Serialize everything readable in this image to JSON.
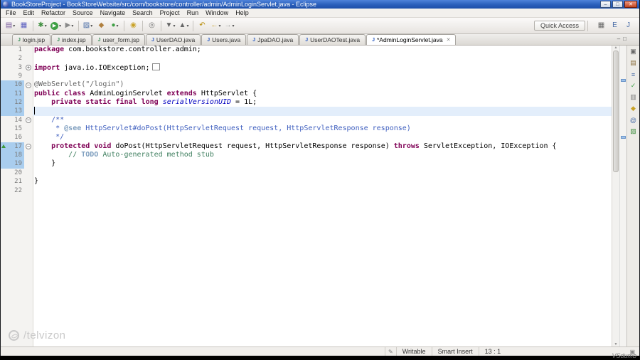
{
  "window": {
    "title": "BookStoreProject - BookStoreWebsite/src/com/bookstore/controller/admin/AdminLoginServlet.java - Eclipse",
    "controls": [
      {
        "name": "minimize-button",
        "glyph": "–"
      },
      {
        "name": "maximize-button",
        "glyph": "□"
      },
      {
        "name": "close-button",
        "glyph": "✕"
      }
    ]
  },
  "menu": {
    "items": [
      "File",
      "Edit",
      "Refactor",
      "Source",
      "Navigate",
      "Search",
      "Project",
      "Run",
      "Window",
      "Help"
    ]
  },
  "toolbar": {
    "quick_access": "Quick Access",
    "groups": [
      {
        "icons": [
          {
            "name": "new-wizard-icon",
            "glyph": "▤",
            "color": "#7a5c9e",
            "dd": true
          },
          {
            "name": "save-icon",
            "glyph": "▦",
            "color": "#5b5fc0"
          }
        ]
      },
      {
        "icons": [
          {
            "name": "debug-icon",
            "glyph": "✱",
            "color": "#3f8f3f",
            "dd": true
          },
          {
            "name": "run-icon",
            "glyph": "▶",
            "color": "#ffffff",
            "bg": "#3fa045",
            "dd": true
          },
          {
            "name": "external-tools-icon",
            "glyph": "▶",
            "color": "#8a8a8a",
            "dd": true
          }
        ]
      },
      {
        "icons": [
          {
            "name": "new-java-project-icon",
            "glyph": "▨",
            "color": "#4a6da7",
            "dd": true
          },
          {
            "name": "new-package-icon",
            "glyph": "◆",
            "color": "#b08040"
          },
          {
            "name": "new-class-icon",
            "glyph": "●",
            "color": "#3fa045",
            "dd": true
          }
        ]
      },
      {
        "icons": [
          {
            "name": "search-icon",
            "glyph": "◉",
            "color": "#c9a227"
          }
        ]
      },
      {
        "icons": [
          {
            "name": "mark-occurrences-icon",
            "glyph": "◎",
            "color": "#777777"
          }
        ]
      },
      {
        "icons": [
          {
            "name": "next-annotation-icon",
            "glyph": "▼",
            "color": "#666666",
            "dd": true
          },
          {
            "name": "previous-annotation-icon",
            "glyph": "▲",
            "color": "#666666",
            "dd": true
          }
        ]
      },
      {
        "icons": [
          {
            "name": "last-edit-location-icon",
            "glyph": "↶",
            "color": "#b58900"
          },
          {
            "name": "back-icon",
            "glyph": "←",
            "color": "#c9a227",
            "dd": true
          },
          {
            "name": "forward-icon",
            "glyph": "→",
            "color": "#9a9a9a",
            "dd": true
          }
        ]
      }
    ],
    "perspectives": [
      {
        "name": "open-perspective-icon",
        "glyph": "▦",
        "color": "#666666"
      },
      {
        "name": "java-ee-perspective-icon",
        "glyph": "E",
        "color": "#4a6da7"
      },
      {
        "name": "java-perspective-icon",
        "glyph": "J",
        "color": "#4a6da7"
      }
    ]
  },
  "view_buttons": [
    {
      "name": "minimize-view-icon",
      "glyph": "–"
    },
    {
      "name": "maximize-view-icon",
      "glyph": "□"
    }
  ],
  "tabs": [
    {
      "label": "login.jsp",
      "type": "jsp",
      "active": false
    },
    {
      "label": "index.jsp",
      "type": "jsp",
      "active": false
    },
    {
      "label": "user_form.jsp",
      "type": "jsp",
      "active": false
    },
    {
      "label": "UserDAO.java",
      "type": "java",
      "active": false
    },
    {
      "label": "Users.java",
      "type": "java",
      "active": false
    },
    {
      "label": "JpaDAO.java",
      "type": "java",
      "active": false
    },
    {
      "label": "UserDAOTest.java",
      "type": "java",
      "active": false
    },
    {
      "label": "*AdminLoginServlet.java",
      "type": "java",
      "active": true
    }
  ],
  "ui": {
    "close_glyph": "✕",
    "dropdown_glyph": "▾",
    "scroll_up_glyph": "▲",
    "scroll_down_glyph": "▼",
    "jsp_icon_letter": "J",
    "java_icon_letter": "J"
  },
  "editor": {
    "lines": [
      {
        "n": "1",
        "segs": [
          [
            "kw",
            "package"
          ],
          [
            "pl",
            " com.bookstore.controller.admin;"
          ]
        ]
      },
      {
        "n": "2",
        "segs": []
      },
      {
        "n": "3",
        "fold": "plus",
        "segs": [
          [
            "kw",
            "import"
          ],
          [
            "pl",
            " java.io.IOException;"
          ],
          [
            "box",
            ""
          ]
        ]
      },
      {
        "n": "9",
        "segs": []
      },
      {
        "n": "10",
        "fold": "minus",
        "diff": true,
        "segs": [
          [
            "ann",
            "@WebServlet(\"/login\")"
          ]
        ]
      },
      {
        "n": "11",
        "diff": true,
        "segs": [
          [
            "kw",
            "public"
          ],
          [
            "pl",
            " "
          ],
          [
            "kw",
            "class"
          ],
          [
            "pl",
            " AdminLoginServlet "
          ],
          [
            "kw",
            "extends"
          ],
          [
            "pl",
            " HttpServlet {"
          ]
        ]
      },
      {
        "n": "12",
        "diff": true,
        "segs": [
          [
            "pl",
            "    "
          ],
          [
            "kw",
            "private"
          ],
          [
            "pl",
            " "
          ],
          [
            "kw",
            "static"
          ],
          [
            "pl",
            " "
          ],
          [
            "kw",
            "final"
          ],
          [
            "pl",
            " "
          ],
          [
            "kw",
            "long"
          ],
          [
            "pl",
            " "
          ],
          [
            "fld",
            "serialVersionUID"
          ],
          [
            "pl",
            " = 1L;"
          ]
        ]
      },
      {
        "n": "13",
        "diff": true,
        "current": true,
        "caret": true,
        "segs": []
      },
      {
        "n": "14",
        "fold": "minus",
        "segs": [
          [
            "pl",
            "    "
          ],
          [
            "jdoc",
            "/**"
          ]
        ]
      },
      {
        "n": "15",
        "segs": [
          [
            "pl",
            "     "
          ],
          [
            "jdoc",
            "* "
          ],
          [
            "jtag",
            "@see"
          ],
          [
            "jdoc",
            " HttpServlet#doPost(HttpServletRequest request, HttpServletResponse response)"
          ]
        ]
      },
      {
        "n": "16",
        "segs": [
          [
            "pl",
            "     "
          ],
          [
            "jdoc",
            "*/"
          ]
        ]
      },
      {
        "n": "17",
        "fold": "minus",
        "diff": true,
        "marker": "override",
        "segs": [
          [
            "pl",
            "    "
          ],
          [
            "kw",
            "protected"
          ],
          [
            "pl",
            " "
          ],
          [
            "kw",
            "void"
          ],
          [
            "pl",
            " doPost(HttpServletRequest request, HttpServletResponse response) "
          ],
          [
            "kw",
            "throws"
          ],
          [
            "pl",
            " ServletException, IOException {"
          ]
        ]
      },
      {
        "n": "18",
        "diff": true,
        "segs": [
          [
            "pl",
            "        "
          ],
          [
            "cmt",
            "// "
          ],
          [
            "todo",
            "TODO"
          ],
          [
            "cmt",
            " Auto-generated method stub"
          ]
        ]
      },
      {
        "n": "19",
        "diff": true,
        "segs": [
          [
            "pl",
            "    }"
          ]
        ]
      },
      {
        "n": "20",
        "segs": []
      },
      {
        "n": "21",
        "segs": [
          [
            "pl",
            "}"
          ]
        ]
      },
      {
        "n": "22",
        "segs": []
      }
    ],
    "overview_marks": [
      {
        "top": "11%"
      },
      {
        "top": "30%"
      }
    ]
  },
  "right_strip": [
    {
      "name": "restore-pane-icon",
      "glyph": "▣",
      "color": "#666666"
    },
    {
      "name": "package-explorer-icon",
      "glyph": "▤",
      "color": "#8a6d3b"
    },
    {
      "name": "type-hierarchy-icon",
      "glyph": "≡",
      "color": "#4a6da7"
    },
    {
      "name": "junit-view-icon",
      "glyph": "✓",
      "color": "#3fa045"
    },
    {
      "name": "task-list-icon",
      "glyph": "▥",
      "color": "#777777"
    },
    {
      "name": "problems-view-icon",
      "glyph": "◆",
      "color": "#c9a227"
    },
    {
      "name": "javadoc-view-icon",
      "glyph": "@",
      "color": "#4a6da7"
    },
    {
      "name": "declaration-view-icon",
      "glyph": "▧",
      "color": "#3f8f3f"
    }
  ],
  "status_bar": {
    "left_icon_glyph": "✎",
    "writable": "Writable",
    "insert_mode": "Smart Insert",
    "caret_position": "13 : 1",
    "right_icon_glyph": "▣"
  },
  "watermarks": {
    "channel": "/telvizon",
    "corner": "VSdumb"
  }
}
